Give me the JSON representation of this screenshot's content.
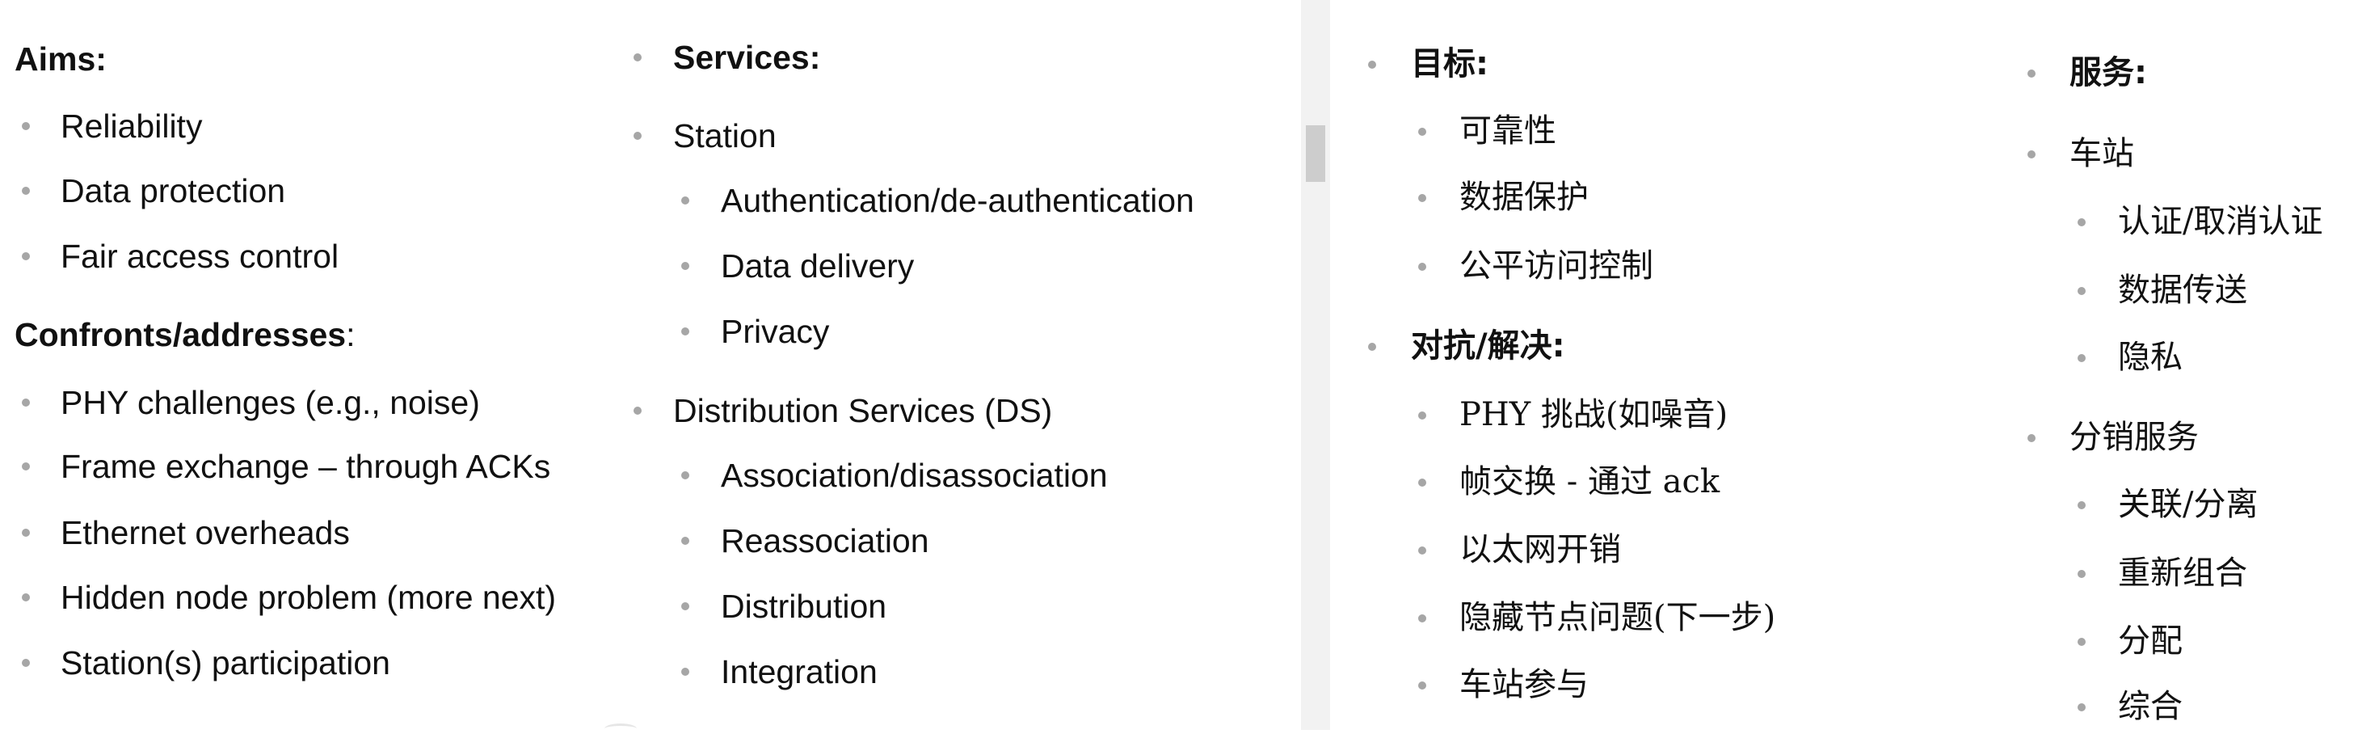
{
  "en": {
    "aims_heading": "Aims:",
    "aims": [
      "Reliability",
      "Data protection",
      "Fair access control"
    ],
    "confronts_heading": "Confronts/addresses",
    "confronts_colon": ":",
    "confronts": [
      "PHY challenges (e.g., noise)",
      "Frame exchange – through ACKs",
      "Ethernet overheads",
      "Hidden node problem (more next)",
      "Station(s) participation"
    ],
    "services_heading": "Services:",
    "station": "Station",
    "station_items": [
      "Authentication/de-authentication",
      "Data delivery",
      "Privacy"
    ],
    "ds": "Distribution Services (DS)",
    "ds_items": [
      "Association/disassociation",
      "Reassociation",
      "Distribution",
      "Integration"
    ]
  },
  "zh": {
    "aims_heading": "目标:",
    "aims": [
      "可靠性",
      "数据保护",
      "公平访问控制"
    ],
    "confronts_heading": "对抗/解决:",
    "confronts": [
      "PHY 挑战(如噪音)",
      "帧交换 - 通过 ack",
      "以太网开销",
      "隐藏节点问题(下一步)",
      "车站参与"
    ],
    "services_heading": "服务:",
    "station": "车站",
    "station_items": [
      "认证/取消认证",
      "数据传送",
      "隐私"
    ],
    "ds": "分销服务",
    "ds_items": [
      "关联/分离",
      "重新组合",
      "分配",
      "综合"
    ]
  }
}
